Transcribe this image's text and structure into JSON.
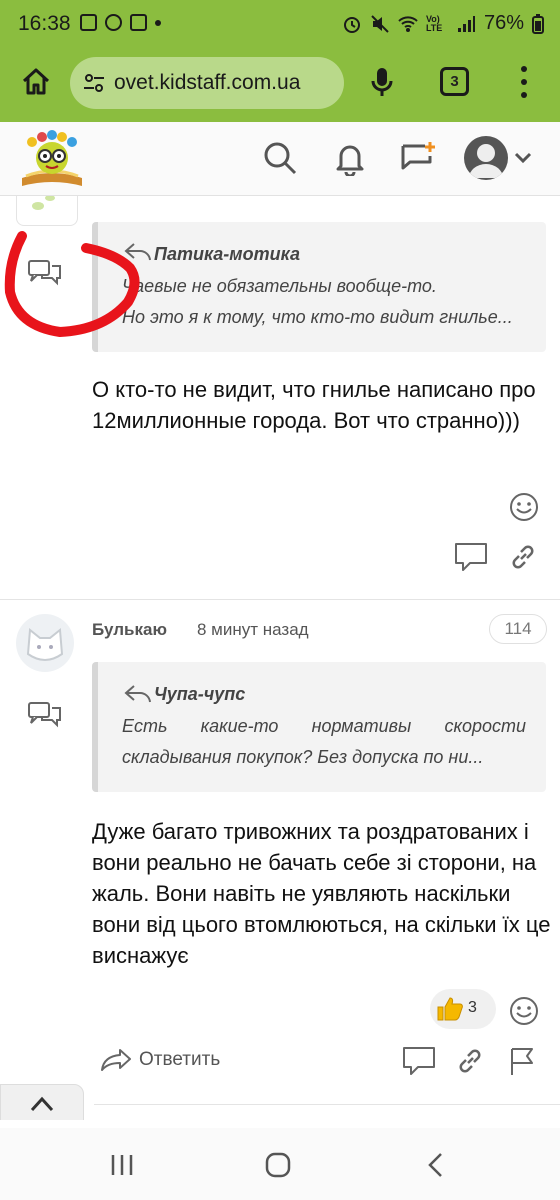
{
  "status_bar": {
    "time": "16:38",
    "battery": "76%",
    "network_label": "Vo) LTE"
  },
  "browser": {
    "url": "ovet.kidstaff.com.ua",
    "tab_count": "3"
  },
  "posts": [
    {
      "quote": {
        "author": "Патика-мотика",
        "lines": [
          "Чаевые не обязательны вообще-то.",
          "Но это я к тому, что кто-то видит гнилье..."
        ]
      },
      "body": "О кто-то не видит, что гнилье написано про 12миллионные города. Вот что странно)))"
    },
    {
      "author": "Булькаю",
      "time": "8 минут назад",
      "number": "114",
      "quote": {
        "author": "Чупа-чупс",
        "lines": [
          "Есть какие-то нормативы скорости",
          "складывания покупок? Без допуска по ни..."
        ]
      },
      "body": "Дуже багато тривожних та роздратованих і вони реально не бачать себе зі сторони, на жаль. Вони навіть не уявляють наскільки вони від цього втомлюються, на скільки їх це виснажує",
      "likes": "3",
      "reply_label": "Ответить"
    }
  ],
  "colors": {
    "browser_bar": "#8bbd3f",
    "url_pill": "#b9d98a",
    "annotation_red": "#e8141b",
    "like_yellow": "#f5b800"
  },
  "icons": [
    "home-icon",
    "site-settings-icon",
    "mic-icon",
    "menu-dots-icon",
    "search-icon",
    "bell-icon",
    "new-message-icon",
    "avatar-icon",
    "chevron-down-icon",
    "chat-bubbles-icon",
    "reply-arrow-icon",
    "smile-icon",
    "comment-icon",
    "link-icon",
    "flag-icon",
    "thumbs-up-icon",
    "chevron-up-icon",
    "recents-icon",
    "home-nav-icon",
    "back-icon"
  ]
}
